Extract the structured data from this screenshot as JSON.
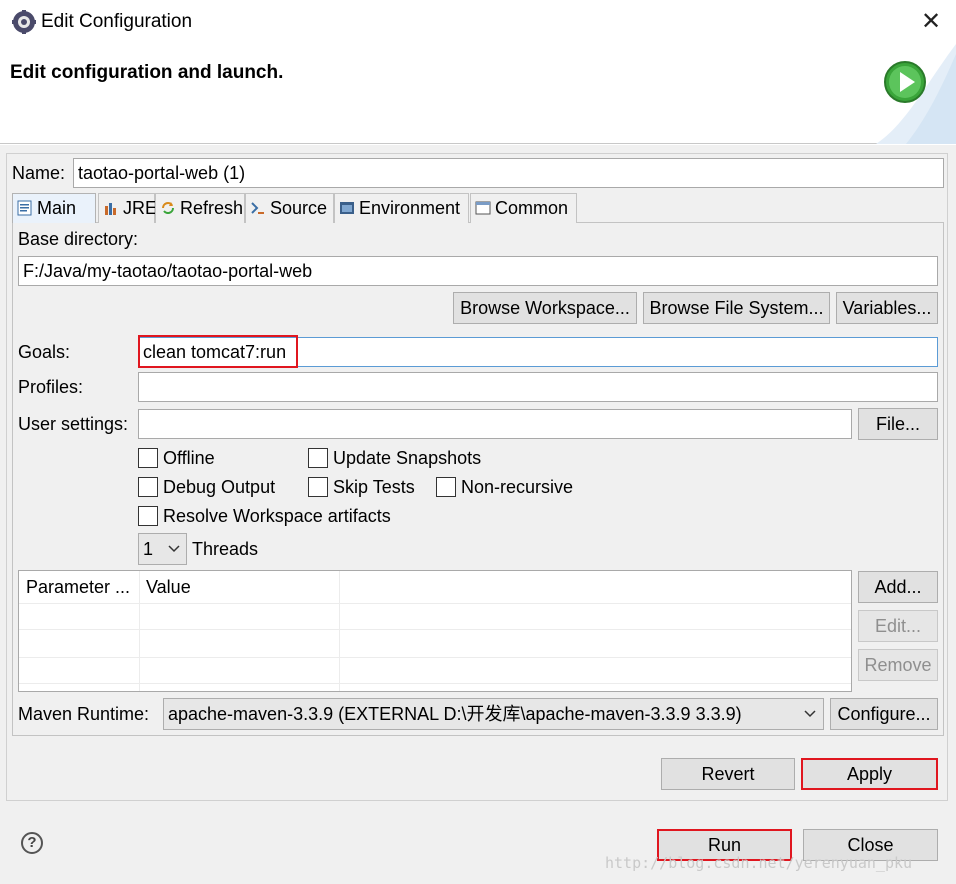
{
  "window": {
    "title": "Edit Configuration",
    "close_glyph": "✕"
  },
  "header": {
    "title": "Edit configuration and launch."
  },
  "name": {
    "label": "Name:",
    "value": "taotao-portal-web (1)"
  },
  "tabs": [
    {
      "label": "Main",
      "icon": "main-tab-icon"
    },
    {
      "label": "JRE",
      "icon": "jre-icon"
    },
    {
      "label": "Refresh",
      "icon": "refresh-icon"
    },
    {
      "label": "Source",
      "icon": "source-icon"
    },
    {
      "label": "Environment",
      "icon": "environment-icon"
    },
    {
      "label": "Common",
      "icon": "common-icon"
    }
  ],
  "main": {
    "base_dir_label": "Base directory:",
    "base_dir_value": "F:/Java/my-taotao/taotao-portal-web",
    "browse_workspace": "Browse Workspace...",
    "browse_fs": "Browse File System...",
    "variables": "Variables...",
    "goals_label": "Goals:",
    "goals_value": "clean tomcat7:run",
    "profiles_label": "Profiles:",
    "profiles_value": "",
    "user_settings_label": "User settings:",
    "user_settings_value": "",
    "file_button": "File...",
    "checkboxes": {
      "offline": "Offline",
      "update_snapshots": "Update Snapshots",
      "debug_output": "Debug Output",
      "skip_tests": "Skip Tests",
      "non_recursive": "Non-recursive",
      "resolve_workspace": "Resolve Workspace artifacts"
    },
    "threads_value": "1",
    "threads_label": "Threads",
    "table_headers": [
      "Parameter ...",
      "Value"
    ],
    "add_button": "Add...",
    "edit_button": "Edit...",
    "remove_button": "Remove",
    "maven_runtime_label": "Maven Runtime:",
    "maven_runtime_value": "apache-maven-3.3.9 (EXTERNAL D:\\开发库\\apache-maven-3.3.9 3.3.9)",
    "configure_button": "Configure..."
  },
  "footer": {
    "revert": "Revert",
    "apply": "Apply",
    "run": "Run",
    "close": "Close"
  },
  "watermark": "http://blog.csdn.net/yerenyuan_pku",
  "colors": {
    "highlight_red": "#e0161f",
    "focus_blue": "#5b9bd5"
  }
}
